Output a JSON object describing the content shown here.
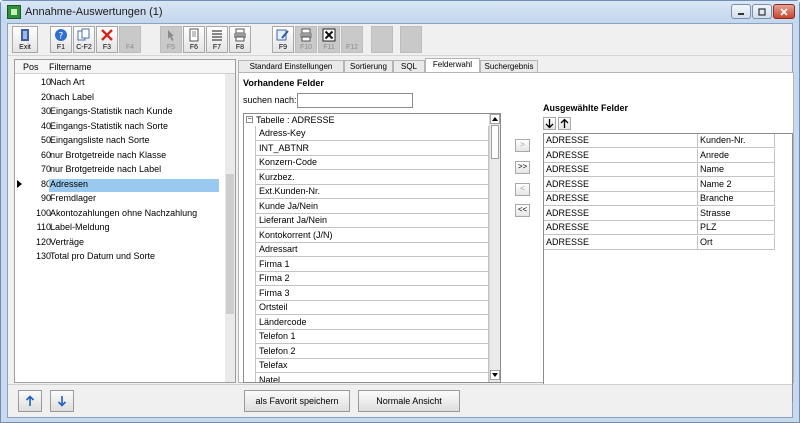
{
  "window": {
    "title": "Annahme-Auswertungen (1)"
  },
  "toolbar": {
    "buttons": [
      {
        "label": "Exit",
        "icon": "exit-door-icon",
        "enabled": true
      },
      {
        "label": "F1",
        "icon": "help-icon",
        "enabled": true
      },
      {
        "label": "C-F2",
        "icon": "copy-icon",
        "enabled": true
      },
      {
        "label": "F3",
        "icon": "delete-x-icon",
        "enabled": true
      },
      {
        "label": "F4",
        "icon": "",
        "enabled": false
      },
      {
        "label": "F5",
        "icon": "pointer-icon",
        "enabled": false
      },
      {
        "label": "F6",
        "icon": "document-icon",
        "enabled": true
      },
      {
        "label": "F7",
        "icon": "list-icon",
        "enabled": true
      },
      {
        "label": "F8",
        "icon": "print-icon",
        "enabled": true
      },
      {
        "label": "F9",
        "icon": "edit-icon",
        "enabled": true
      },
      {
        "label": "F10",
        "icon": "print-icon",
        "enabled": false
      },
      {
        "label": "F11",
        "icon": "excel-icon",
        "enabled": false
      },
      {
        "label": "F12",
        "icon": "",
        "enabled": false
      },
      {
        "label": "",
        "icon": "",
        "enabled": false
      },
      {
        "label": "",
        "icon": "",
        "enabled": false
      }
    ]
  },
  "filter_list": {
    "headers": {
      "pos": "Pos",
      "name": "Filtername"
    },
    "rows": [
      {
        "pos": "10",
        "name": "Nach Art"
      },
      {
        "pos": "20",
        "name": "nach Label"
      },
      {
        "pos": "30",
        "name": "Eingangs-Statistik nach Kunde"
      },
      {
        "pos": "40",
        "name": "Eingangs-Statistik nach Sorte"
      },
      {
        "pos": "50",
        "name": "Eingangsliste nach Sorte"
      },
      {
        "pos": "60",
        "name": "nur Brotgetreide nach Klasse"
      },
      {
        "pos": "70",
        "name": "nur Brotgetreide nach Label"
      },
      {
        "pos": "80",
        "name": "Adressen"
      },
      {
        "pos": "90",
        "name": "Fremdlager"
      },
      {
        "pos": "100",
        "name": "Akontozahlungen ohne Nachzahlung"
      },
      {
        "pos": "110",
        "name": "Label-Meldung"
      },
      {
        "pos": "120",
        "name": "Verträge"
      },
      {
        "pos": "130",
        "name": "Total pro Datum und Sorte"
      }
    ],
    "selected_index": 7
  },
  "tabs": [
    {
      "label": "Standard Einstellungen",
      "active": false
    },
    {
      "label": "Sortierung",
      "active": false
    },
    {
      "label": "SQL",
      "active": false
    },
    {
      "label": "Felderwahl",
      "active": true
    },
    {
      "label": "Suchergebnis",
      "active": false
    }
  ],
  "available_fields": {
    "title": "Vorhandene Felder",
    "search_label": "suchen nach:",
    "search_value": "",
    "group": "Tabelle : ADRESSE",
    "items": [
      "Adress-Key",
      "INT_ABTNR",
      "Konzern-Code",
      "Kurzbez.",
      "Ext.Kunden-Nr.",
      "Kunde Ja/Nein",
      "Lieferant Ja/Nein",
      "Kontokorrent (J/N)",
      "Adressart",
      "Firma 1",
      "Firma 2",
      "Firma 3",
      "Ortsteil",
      "Ländercode",
      "Telefon 1",
      "Telefon 2",
      "Telefax",
      "Natel"
    ]
  },
  "move_buttons": [
    {
      "label": ">",
      "enabled": false
    },
    {
      "label": ">>",
      "enabled": true
    },
    {
      "label": "<",
      "enabled": false
    },
    {
      "label": "<<",
      "enabled": true
    }
  ],
  "selected_fields": {
    "title": "Ausgewählte Felder",
    "rows": [
      {
        "table": "ADRESSE",
        "field": "Kunden-Nr."
      },
      {
        "table": "ADRESSE",
        "field": "Anrede"
      },
      {
        "table": "ADRESSE",
        "field": "Name"
      },
      {
        "table": "ADRESSE",
        "field": "Name 2"
      },
      {
        "table": "ADRESSE",
        "field": "Branche"
      },
      {
        "table": "ADRESSE",
        "field": "Strasse"
      },
      {
        "table": "ADRESSE",
        "field": "PLZ"
      },
      {
        "table": "ADRESSE",
        "field": "Ort"
      }
    ]
  },
  "bottom": {
    "favorite_label": "als Favorit speichern",
    "normal_view_label": "Normale Ansicht"
  },
  "colors": {
    "selection": "#99c9ef",
    "titlebar": "#c3d6ed",
    "nav_arrow": "#1f5fc2"
  }
}
